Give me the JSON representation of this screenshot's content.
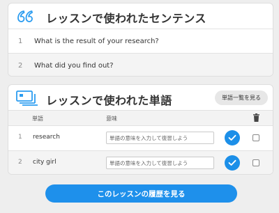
{
  "sentences_card": {
    "title": "レッスンで使われたセンテンス",
    "rows": [
      {
        "num": "1",
        "text": "What is the result of your research?"
      },
      {
        "num": "2",
        "text": "What did you find out?"
      }
    ]
  },
  "words_card": {
    "title": "レッスンで使われた単語",
    "word_list_button": "単語一覧を見る",
    "header": {
      "word": "単語",
      "meaning": "意味"
    },
    "rows": [
      {
        "num": "1",
        "word": "research",
        "meaning_value": "",
        "meaning_placeholder": "単語の意味を入力して復習しよう"
      },
      {
        "num": "2",
        "word": "city girl",
        "meaning_value": "",
        "meaning_placeholder": "単語の意味を入力して復習しよう"
      }
    ]
  },
  "history_button": "このレッスンの履歴を見る",
  "icons": {
    "quote": "quote-icon",
    "vocab": "vocabulary-card-icon",
    "trash": "trash-icon",
    "check": "check-icon"
  },
  "colors": {
    "accent": "#1e90eb",
    "icon_blue": "#2a9cf0",
    "background": "#eeeeee"
  }
}
